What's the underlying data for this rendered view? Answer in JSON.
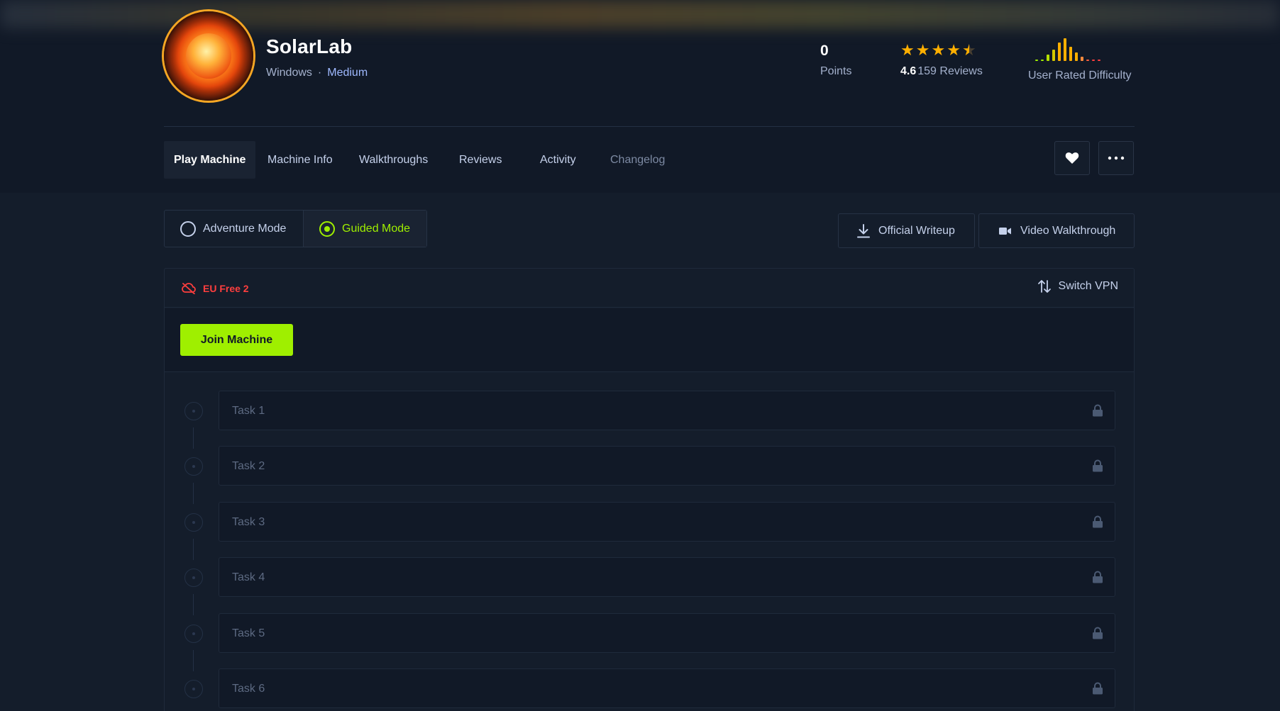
{
  "machine": {
    "name": "SolarLab",
    "os": "Windows",
    "separator": "·",
    "difficulty": "Medium"
  },
  "stats": {
    "points_value": "0",
    "points_label": "Points",
    "rating_score": "4.6",
    "rating_reviews": "159 Reviews",
    "rating_stars": 4.6,
    "difficulty_label": "User Rated Difficulty"
  },
  "tabs": [
    {
      "label": "Play Machine",
      "active": true
    },
    {
      "label": "Machine Info"
    },
    {
      "label": "Walkthroughs"
    },
    {
      "label": "Reviews"
    },
    {
      "label": "Activity"
    },
    {
      "label": "Changelog"
    }
  ],
  "modes": {
    "adventure_label": "Adventure Mode",
    "guided_label": "Guided Mode",
    "selected": "Guided Mode"
  },
  "actions": {
    "writeup_label": "Official Writeup",
    "video_label": "Video Walkthrough"
  },
  "vpn": {
    "server_name": "EU Free 2",
    "switch_label": "Switch VPN"
  },
  "join_label": "Join Machine",
  "tasks": [
    {
      "label": "Task 1",
      "locked": true
    },
    {
      "label": "Task 2",
      "locked": true
    },
    {
      "label": "Task 3",
      "locked": true
    },
    {
      "label": "Task 4",
      "locked": true
    },
    {
      "label": "Task 5",
      "locked": true
    },
    {
      "label": "Task 6",
      "locked": true
    }
  ],
  "colors": {
    "accent_green": "#9fef00",
    "star_orange": "#ffaf00",
    "vpn_red": "#ff3e3e",
    "background": "#141d2b",
    "difficulty_link": "#9fb9ff"
  },
  "icons": {
    "favorite": "heart-icon",
    "more": "more-dots-icon",
    "writeup": "download-icon",
    "video": "video-camera-icon",
    "vpn_status": "cloud-off-icon",
    "switch_vpn": "switch-arrows-icon",
    "task": "lock-icon"
  }
}
